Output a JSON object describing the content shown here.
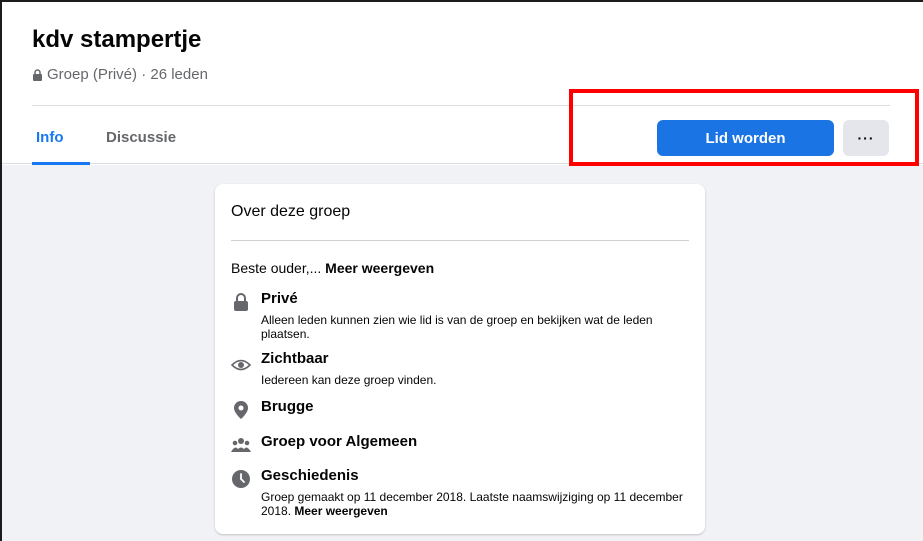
{
  "group": {
    "name": "kdv stampertje",
    "subtitle": "Groep (Privé) · 26 leden"
  },
  "tabs": [
    {
      "label": "Info",
      "active": true
    },
    {
      "label": "Discussie",
      "active": false
    }
  ],
  "actions": {
    "join_label": "Lid worden",
    "more_label": "···"
  },
  "about": {
    "title": "Over deze groep",
    "intro_text": "Beste ouder,... ",
    "intro_more": "Meer weergeven",
    "items": [
      {
        "icon": "lock-icon",
        "title": "Privé",
        "desc": "Alleen leden kunnen zien wie lid is van de groep en bekijken wat de leden plaatsen."
      },
      {
        "icon": "eye-icon",
        "title": "Zichtbaar",
        "desc": "Iedereen kan deze groep vinden."
      },
      {
        "icon": "location-pin-icon",
        "title": "Brugge",
        "desc": ""
      },
      {
        "icon": "people-icon",
        "title": "Groep voor Algemeen",
        "desc": ""
      },
      {
        "icon": "clock-icon",
        "title": "Geschiedenis",
        "desc": "Groep gemaakt op 11 december 2018. Laatste naamswijziging op 11 december 2018. ",
        "desc_more": "Meer weergeven"
      }
    ]
  },
  "colors": {
    "accent": "#1b74e4",
    "highlight": "#ff0000",
    "background": "#f0f2f5"
  }
}
